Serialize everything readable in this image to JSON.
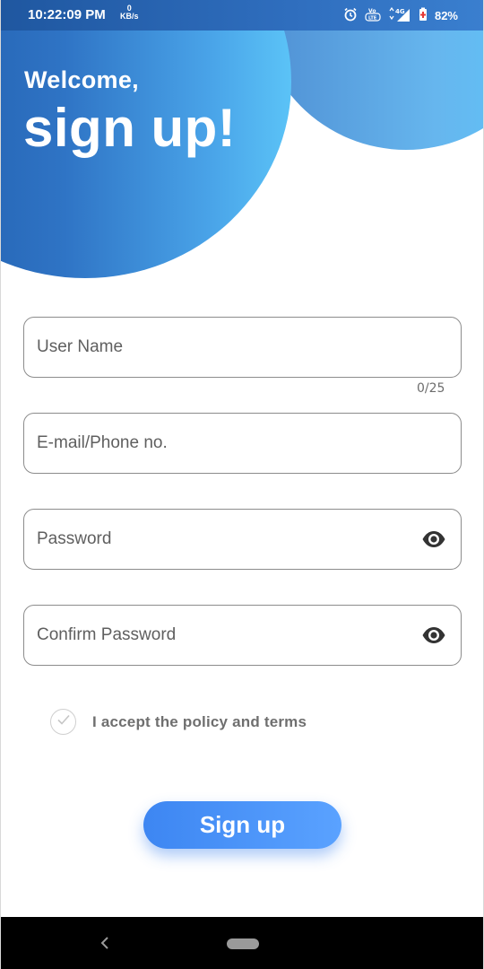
{
  "status_bar": {
    "time": "10:22:09 PM",
    "kbs_value": "0",
    "kbs_unit": "KB/s",
    "network": "4G",
    "battery": "82%"
  },
  "header": {
    "welcome": "Welcome,",
    "title": "sign up!"
  },
  "form": {
    "username_placeholder": "User Name",
    "username_counter": "0/25",
    "email_placeholder": "E-mail/Phone no.",
    "password_placeholder": "Password",
    "confirm_placeholder": "Confirm Password",
    "terms_label": "I accept the policy and terms",
    "submit_label": "Sign up"
  },
  "icons": {
    "alarm": "alarm-icon",
    "volte": "volte-icon",
    "signal": "signal-icon",
    "battery": "battery-icon",
    "eye": "eye-icon",
    "check": "check-icon",
    "back": "back-icon",
    "home": "home-pill-icon"
  },
  "colors": {
    "accent": "#4a93f8",
    "header_dark": "#1e58a6",
    "header_light": "#5bc3f7"
  }
}
